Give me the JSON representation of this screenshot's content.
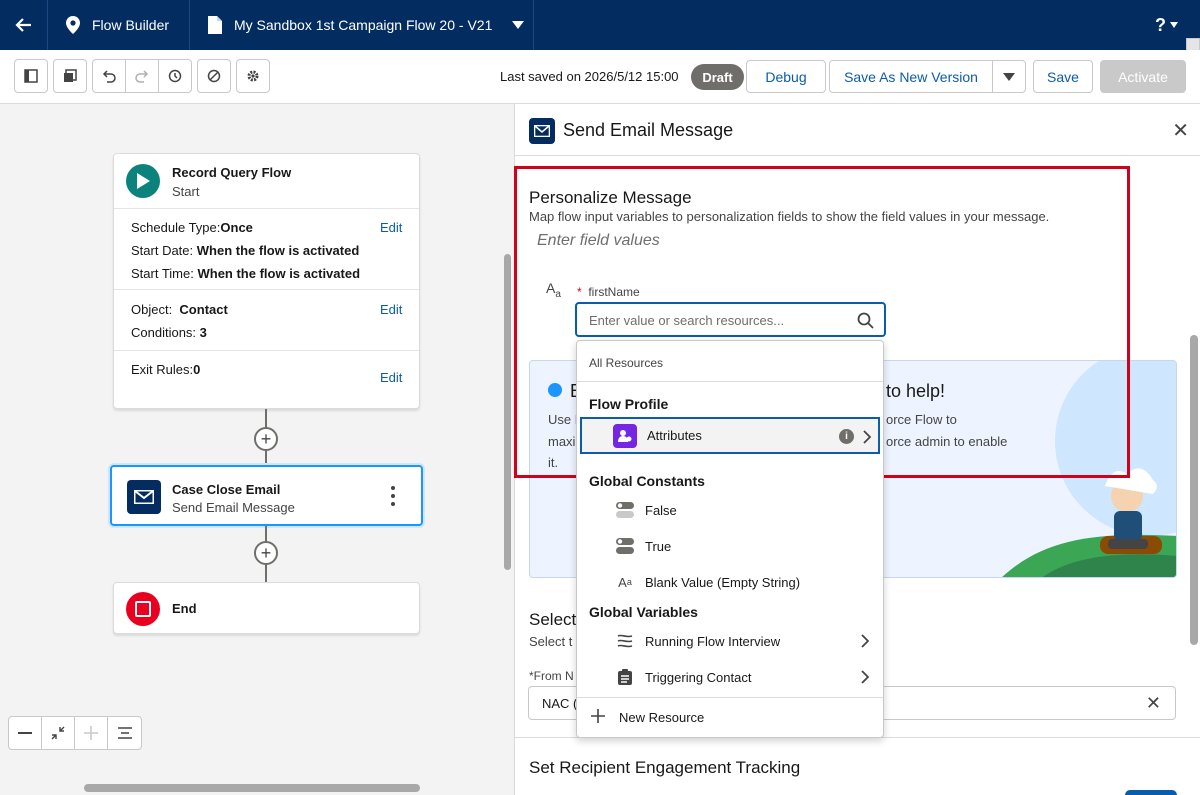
{
  "topbar": {
    "app_name": "Flow Builder",
    "flow_name": "My Sandbox 1st Campaign Flow 20 - V21",
    "help": "?"
  },
  "toolbar": {
    "last_saved": "Last saved on 2026/5/12 15:00",
    "status": "Draft",
    "debug": "Debug",
    "save_as_new_version": "Save As New Version",
    "save": "Save",
    "activate": "Activate"
  },
  "canvas": {
    "start": {
      "title": "Record Query Flow",
      "subtitle": "Start",
      "schedule_type_label": "Schedule Type:",
      "schedule_type_value": "Once",
      "start_date_label": "Start Date:",
      "start_date_value": "When the flow is activated",
      "start_time_label": "Start Time:",
      "start_time_value": "When the flow is activated",
      "object_label": "Object:",
      "object_value": "Contact",
      "conditions_label": "Conditions:",
      "conditions_value": "3",
      "exit_rules_label": "Exit Rules:",
      "exit_rules_value": "0",
      "edit": "Edit"
    },
    "email_node": {
      "title": "Case Close Email",
      "subtitle": "Send Email Message"
    },
    "end_node": {
      "title": "End"
    }
  },
  "panel": {
    "title": "Send Email Message",
    "personalize": {
      "heading": "Personalize Message",
      "description": "Map flow input variables to personalization fields to show the field values in your message.",
      "hint": "Enter field values",
      "field_label": "firstName",
      "required_mark": "*",
      "input_placeholder": "Enter value or search resources..."
    },
    "promo": {
      "partial_heading_left": "E",
      "partial_heading_right": "to help!",
      "line1_left": "Use E",
      "line1_right": "orce Flow to",
      "line2_left": "maxi",
      "line2_right": "orce admin to enable",
      "line3_left": "it."
    },
    "select_section": {
      "heading": "Select",
      "sub": "Select t",
      "from_label": "*From N",
      "from_value": "NAC ("
    },
    "tracking_heading": "Set Recipient Engagement Tracking"
  },
  "dropdown": {
    "all_resources": "All Resources",
    "flow_profile": "Flow Profile",
    "attributes": "Attributes",
    "global_constants": "Global Constants",
    "false": "False",
    "true": "True",
    "blank_value": "Blank Value (Empty String)",
    "global_variables": "Global Variables",
    "running_flow_interview": "Running Flow Interview",
    "triggering_contact": "Triggering Contact",
    "new_resource": "New Resource"
  },
  "colors": {
    "header_bg": "#032d60",
    "brand_blue": "#0b5cab",
    "highlight_red": "#d0021b",
    "attributes_icon": "#7526e3",
    "start_icon": "#0b827c",
    "end_icon": "#ea001e"
  }
}
